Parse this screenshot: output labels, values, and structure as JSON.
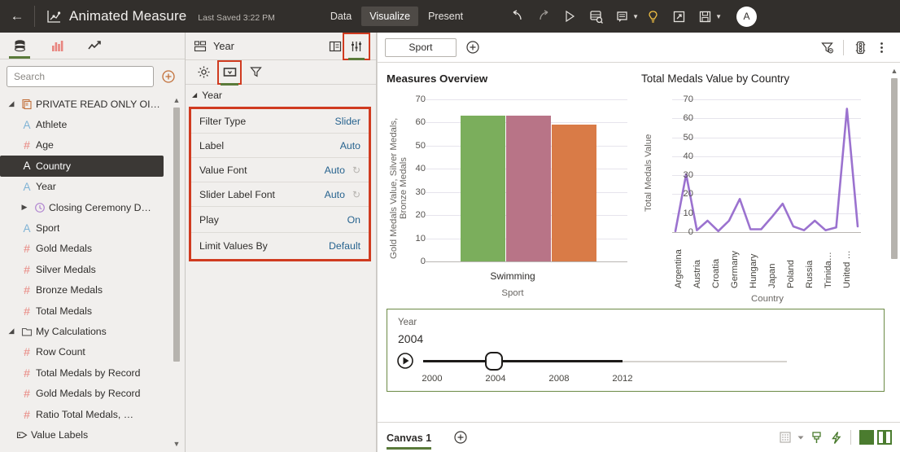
{
  "topbar": {
    "back_icon": "arrow-left-icon",
    "app_icon": "chart-scatter-icon",
    "title": "Animated Measure",
    "saved": "Last Saved 3:22 PM",
    "tabs": [
      {
        "label": "Data",
        "active": false
      },
      {
        "label": "Visualize",
        "active": true
      },
      {
        "label": "Present",
        "active": false
      }
    ],
    "actions": [
      "undo-icon",
      "redo-icon",
      "play-icon",
      "data-refresh-icon",
      "notes-icon",
      "insights-lightbulb-icon",
      "share-export-icon",
      "save-icon"
    ],
    "avatar_initial": "A"
  },
  "sidebar": {
    "tabs": [
      {
        "name": "data-panel-tab",
        "icon": "database-icon",
        "active": true
      },
      {
        "name": "visualizations-tab",
        "icon": "bar-chart-icon",
        "active": false
      },
      {
        "name": "analytics-tab",
        "icon": "trend-line-icon",
        "active": false
      }
    ],
    "search_placeholder": "Search",
    "add_label": "+",
    "tree": [
      {
        "label": "PRIVATE READ ONLY OI…",
        "icon": "dataset-icon",
        "twisty": "expanded",
        "indent": 0,
        "selected": false
      },
      {
        "label": "Athlete",
        "icon": "attribute-text-icon",
        "twisty": "",
        "indent": 1,
        "selected": false
      },
      {
        "label": "Age",
        "icon": "measure-number-icon",
        "twisty": "",
        "indent": 1,
        "selected": false
      },
      {
        "label": "Country",
        "icon": "attribute-text-icon",
        "twisty": "",
        "indent": 1,
        "selected": true
      },
      {
        "label": "Year",
        "icon": "attribute-text-icon",
        "twisty": "",
        "indent": 1,
        "selected": false
      },
      {
        "label": "Closing Ceremony D…",
        "icon": "date-clock-icon",
        "twisty": "collapsed",
        "indent": 1,
        "selected": false
      },
      {
        "label": "Sport",
        "icon": "attribute-text-icon",
        "twisty": "",
        "indent": 1,
        "selected": false
      },
      {
        "label": "Gold Medals",
        "icon": "measure-number-icon",
        "twisty": "",
        "indent": 1,
        "selected": false
      },
      {
        "label": "Silver Medals",
        "icon": "measure-number-icon",
        "twisty": "",
        "indent": 1,
        "selected": false
      },
      {
        "label": "Bronze Medals",
        "icon": "measure-number-icon",
        "twisty": "",
        "indent": 1,
        "selected": false
      },
      {
        "label": "Total Medals",
        "icon": "measure-number-icon",
        "twisty": "",
        "indent": 1,
        "selected": false
      },
      {
        "label": "My Calculations",
        "icon": "folder-icon",
        "twisty": "expanded",
        "indent": 0,
        "selected": false
      },
      {
        "label": "Row Count",
        "icon": "measure-number-icon",
        "twisty": "",
        "indent": 1,
        "selected": false
      },
      {
        "label": "Total Medals by Record",
        "icon": "measure-number-icon",
        "twisty": "",
        "indent": 1,
        "selected": false
      },
      {
        "label": "Gold Medals by Record",
        "icon": "measure-number-icon",
        "twisty": "",
        "indent": 1,
        "selected": false
      },
      {
        "label": "Ratio Total Medals, …",
        "icon": "measure-number-icon",
        "twisty": "",
        "indent": 1,
        "selected": false
      },
      {
        "label": "Value Labels",
        "icon": "tag-icon",
        "twisty": "",
        "indent": 0,
        "selected": false
      }
    ]
  },
  "properties": {
    "header_icon": "filter-control-icon",
    "header_title": "Year",
    "header_buttons": [
      {
        "name": "general-layout-button",
        "icon": "layout-panel-icon",
        "highlighted": false,
        "active": false
      },
      {
        "name": "properties-button",
        "icon": "sliders-icon",
        "highlighted": true,
        "active": true
      }
    ],
    "sub_buttons": [
      {
        "name": "general-settings-button",
        "icon": "gear-icon",
        "highlighted": false,
        "active": false
      },
      {
        "name": "filter-control-button",
        "icon": "dropdown-box-icon",
        "highlighted": true,
        "active": true
      },
      {
        "name": "filter-button",
        "icon": "funnel-icon",
        "highlighted": false,
        "active": false
      }
    ],
    "section_label": "Year",
    "rows": [
      {
        "name": "Filter Type",
        "value": "Slider",
        "reset": false
      },
      {
        "name": "Label",
        "value": "Auto",
        "reset": false
      },
      {
        "name": "Value Font",
        "value": "Auto",
        "reset": true
      },
      {
        "name": "Slider Label Font",
        "value": "Auto",
        "reset": true
      },
      {
        "name": "Play",
        "value": "On",
        "reset": false
      },
      {
        "name": "Limit Values By",
        "value": "Default",
        "reset": false
      }
    ]
  },
  "filterbar": {
    "chips": [
      {
        "label": "Sport"
      }
    ],
    "add_label": "+",
    "right_icons": [
      "filter-remove-icon",
      "data-actions-icon",
      "more-options-icon"
    ]
  },
  "slider": {
    "title": "Year",
    "value": "2004",
    "play_icon": "play-circle-icon",
    "ticks": [
      "2000",
      "2004",
      "2008",
      "2012"
    ]
  },
  "bottombar": {
    "canvas_tab": "Canvas 1",
    "add_label": "+",
    "right_icons": [
      "grid-layout-icon",
      "caret-down-icon",
      "brush-icon",
      "lightning-icon",
      "layout-full-icon",
      "layout-split-icon"
    ]
  },
  "colors": {
    "accent_green": "#5a7a3a",
    "highlight_red": "#d03b20",
    "link_blue": "#27638f",
    "bar_green": "#7bae5c",
    "bar_mauve": "#b87487",
    "bar_orange": "#d97b47",
    "line_purple": "#9b72cf",
    "topbar_bg": "#322f2c"
  },
  "chart_data": [
    {
      "type": "bar",
      "title": "Measures Overview",
      "xlabel": "Sport",
      "ylabel": "Gold Medals Value, Silver Medals, Bronze Medals",
      "categories": [
        "Swimming"
      ],
      "yticks": [
        0,
        10,
        20,
        30,
        40,
        50,
        60,
        70
      ],
      "ylim": [
        0,
        70
      ],
      "grid": true,
      "legend": "none",
      "series": [
        {
          "name": "Gold Medals Value",
          "values": [
            63
          ],
          "color": "#7bae5c"
        },
        {
          "name": "Silver Medals",
          "values": [
            63
          ],
          "color": "#b87487"
        },
        {
          "name": "Bronze Medals",
          "values": [
            59
          ],
          "color": "#d97b47"
        }
      ]
    },
    {
      "type": "line",
      "title": "Total Medals Value by Country",
      "xlabel": "Country",
      "ylabel": "Total Medals Value",
      "yticks": [
        0,
        10,
        20,
        30,
        40,
        50,
        60,
        70
      ],
      "ylim": [
        0,
        70
      ],
      "grid": true,
      "legend": "none",
      "xtick_labels": [
        "Argentina",
        "Austria",
        "Croatia",
        "Germany",
        "Hungary",
        "Japan",
        "Poland",
        "Russia",
        "Trinida…",
        "United …"
      ],
      "x": [
        1,
        2,
        3,
        4,
        5,
        6,
        7,
        8,
        9,
        10,
        11,
        12,
        13,
        14,
        15,
        16,
        17,
        18,
        19,
        20
      ],
      "values": [
        0.5,
        30.5,
        1,
        6,
        0.5,
        6,
        17.5,
        1.5,
        1.5,
        8,
        15,
        3,
        1,
        6,
        1,
        2.5,
        65,
        3
      ]
    }
  ]
}
